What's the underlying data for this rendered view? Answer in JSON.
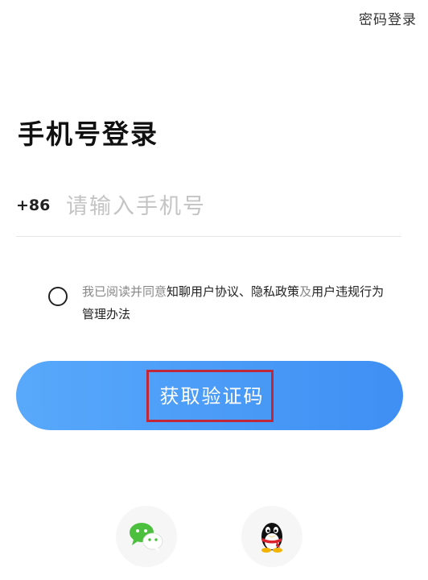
{
  "header": {
    "password_login_label": "密码登录"
  },
  "title": "手机号登录",
  "phone": {
    "country_code": "+86",
    "placeholder": "请输入手机号",
    "value": ""
  },
  "agreement": {
    "prefix": "我已阅读并同意",
    "user_agreement": "知聊用户协议",
    "sep": "、",
    "privacy_policy": "隐私政策",
    "and": "及",
    "violation_rules": "用户违规行为管理办法"
  },
  "get_code_label": "获取验证码",
  "social": {
    "wechat_icon": "wechat-icon",
    "qq_icon": "qq-icon"
  },
  "colors": {
    "button_start": "#58a9fb",
    "button_end": "#3f8ff4",
    "highlight_box": "#c0283a",
    "wechat_green": "#4cbf3f"
  }
}
